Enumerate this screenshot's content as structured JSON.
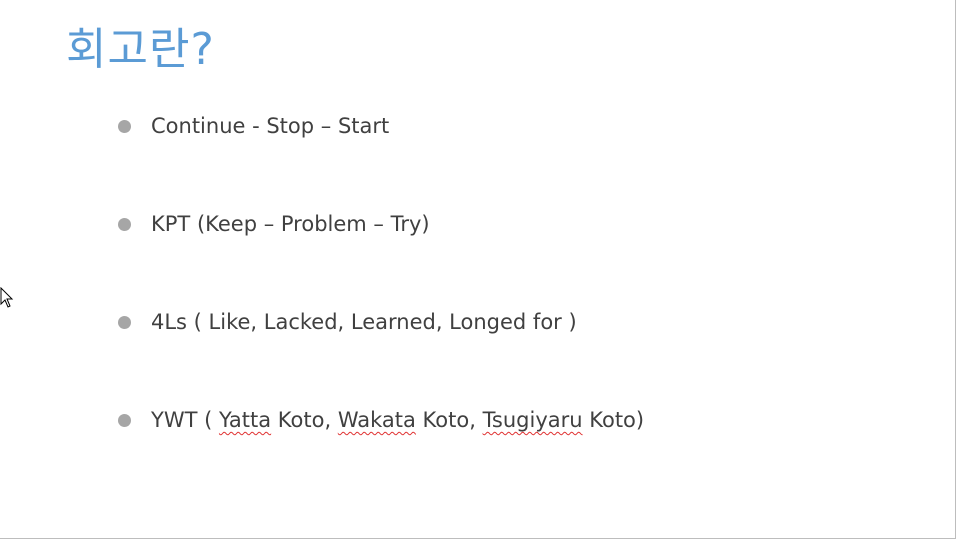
{
  "slide": {
    "title": "회고란?",
    "bullets": [
      {
        "text": "Continue - Stop – Start"
      },
      {
        "text": "KPT (Keep – Problem – Try)"
      },
      {
        "text": "4Ls ( Like, Lacked, Learned, Longed for )"
      },
      {
        "parts": [
          "YWT ( ",
          "Yatta",
          " Koto, ",
          "Wakata",
          " Koto, ",
          "Tsugiyaru",
          " Koto)"
        ]
      }
    ]
  },
  "colors": {
    "title": "#5b9bd5",
    "bullet_text": "#404040",
    "bullet_dot": "#a6a6a6",
    "spellcheck": "#e03131"
  },
  "icons": {
    "cursor": "mouse-pointer-icon",
    "bullet": "bullet-dot-icon"
  }
}
